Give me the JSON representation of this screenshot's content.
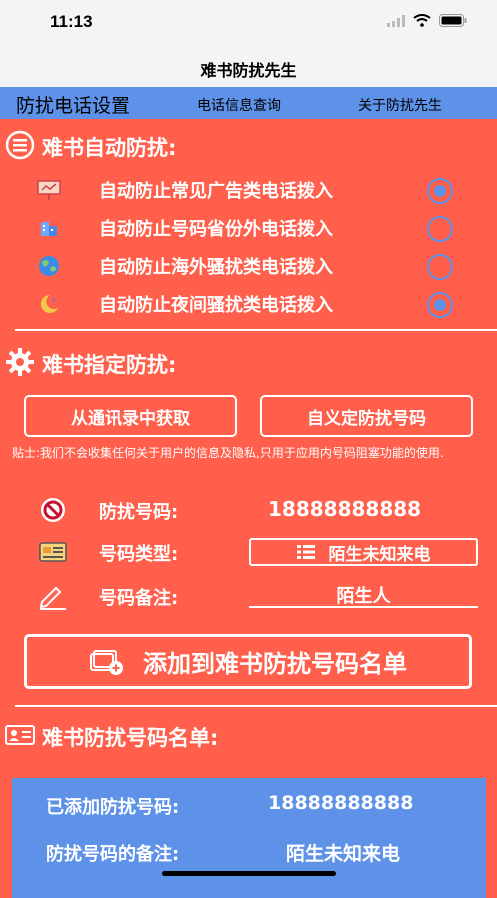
{
  "status_bar": {
    "time": "11:13"
  },
  "nav": {
    "title": "难书防扰先生"
  },
  "tabs": [
    {
      "label": "防扰电话设置"
    },
    {
      "label": "电话信息查询"
    },
    {
      "label": "关于防扰先生"
    }
  ],
  "auto_section": {
    "title": "难书自动防扰:",
    "options": [
      {
        "label": "自动防止常见广告类电话拨入",
        "icon": "billboard-icon",
        "checked": true
      },
      {
        "label": "自动防止号码省份外电话拨入",
        "icon": "building-icon",
        "checked": false
      },
      {
        "label": "自动防止海外骚扰类电话拨入",
        "icon": "globe-icon",
        "checked": false
      },
      {
        "label": "自动防止夜间骚扰类电话拨入",
        "icon": "moon-icon",
        "checked": true
      }
    ]
  },
  "custom_section": {
    "title": "难书指定防扰:",
    "contacts_button": "从通讯录中获取",
    "custom_button": "自义定防扰号码",
    "note": "贴士:我们不会收集任何关于用户的信息及隐私,只用于应用内号码阻塞功能的使用.",
    "number_label": "防扰号码:",
    "number_value": "18888888888",
    "type_label": "号码类型:",
    "type_value": "陌生未知来电",
    "remark_label": "号码备注:",
    "remark_value": "陌生人",
    "add_button": "添加到难书防扰号码名单"
  },
  "list_section": {
    "title": "难书防扰号码名单:",
    "card": {
      "added_label": "已添加防扰号码:",
      "added_value": "18888888888",
      "remark_label": "防扰号码的备注:",
      "remark_value": "陌生未知来电"
    }
  },
  "colors": {
    "background": "#FF5F4B",
    "accent": "#5E92E8",
    "bar": "#F4F4F4"
  }
}
